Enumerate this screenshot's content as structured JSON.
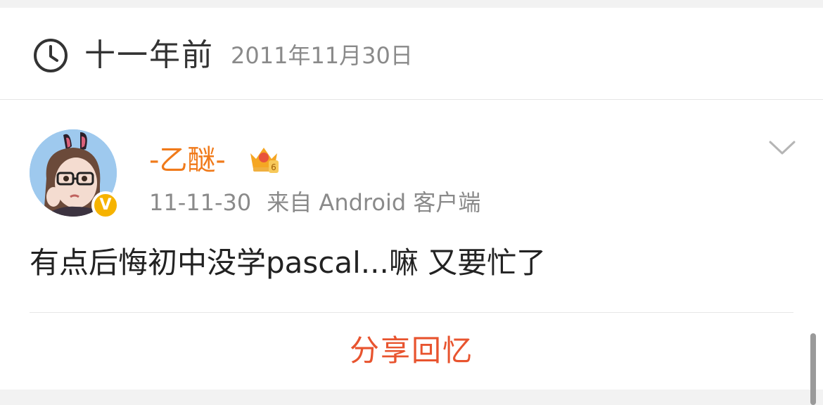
{
  "memory_header": {
    "ago_label": "十一年前",
    "date": "2011年11月30日",
    "icon": "clock-icon"
  },
  "post": {
    "username": "-乙醚-",
    "verified_badge": "V",
    "vip_icon": "vip-crown-icon",
    "time": "11-11-30",
    "source": "来自 Android 客户端",
    "text": "有点后悔初中没学pascal...嘛 又要忙了",
    "more_icon": "chevron-down-icon"
  },
  "actions": {
    "share_label": "分享回忆"
  },
  "colors": {
    "username": "#f07a1a",
    "share": "#e8542f",
    "badge": "#f6b300",
    "meta": "#8a8a8a"
  }
}
